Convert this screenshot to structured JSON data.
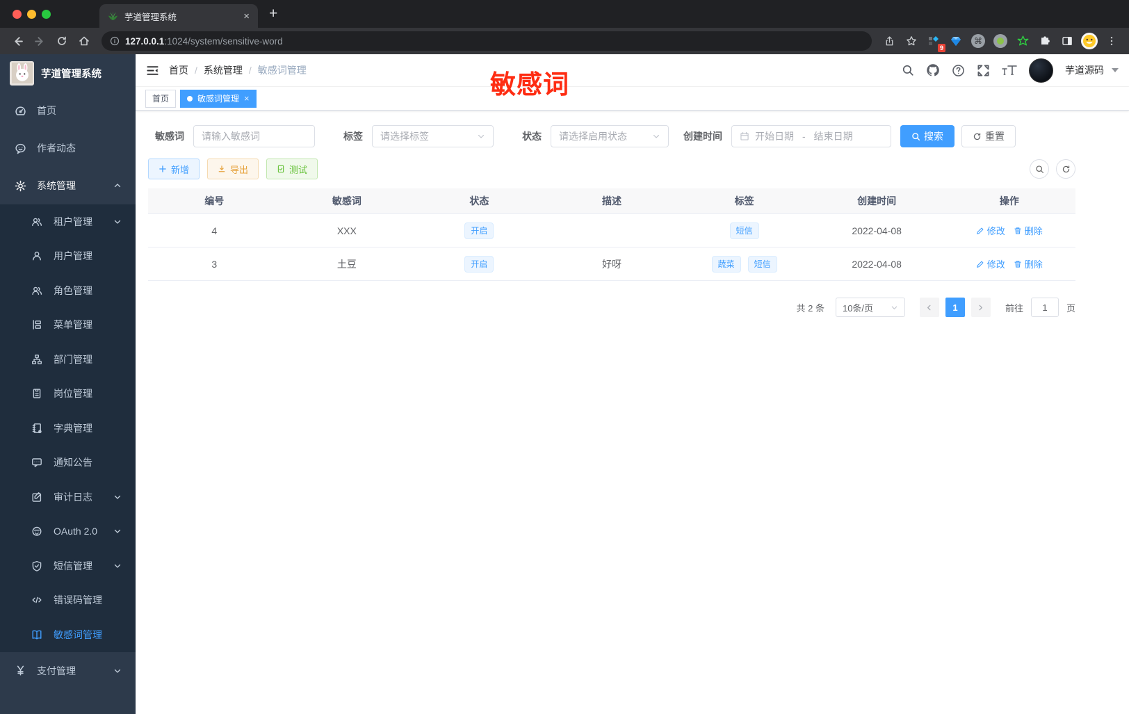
{
  "browser": {
    "tab_title": "芋道管理系统",
    "url_host": "127.0.0.1",
    "url_path": ":1024/system/sensitive-word",
    "extension_badge": "9",
    "new_tab": "+",
    "tab_close": "×"
  },
  "sidebar": {
    "logo_title": "芋道管理系统",
    "items": [
      {
        "label": "首页"
      },
      {
        "label": "作者动态"
      },
      {
        "label": "系统管理"
      }
    ],
    "sub_items": [
      {
        "label": "租户管理"
      },
      {
        "label": "用户管理"
      },
      {
        "label": "角色管理"
      },
      {
        "label": "菜单管理"
      },
      {
        "label": "部门管理"
      },
      {
        "label": "岗位管理"
      },
      {
        "label": "字典管理"
      },
      {
        "label": "通知公告"
      },
      {
        "label": "审计日志"
      },
      {
        "label": "OAuth 2.0"
      },
      {
        "label": "短信管理"
      },
      {
        "label": "错误码管理"
      },
      {
        "label": "敏感词管理"
      }
    ],
    "bottom_items": [
      {
        "label": "支付管理"
      }
    ]
  },
  "header": {
    "breadcrumb": [
      "首页",
      "系统管理",
      "敏感词管理"
    ],
    "separator": "/",
    "user_name": "芋道源码"
  },
  "annotation": {
    "text": "敏感词"
  },
  "tabs": [
    {
      "label": "首页"
    },
    {
      "label": "敏感词管理",
      "close": "×"
    }
  ],
  "filters": {
    "keyword_label": "敏感词",
    "keyword_placeholder": "请输入敏感词",
    "tag_label": "标签",
    "tag_placeholder": "请选择标签",
    "status_label": "状态",
    "status_placeholder": "请选择启用状态",
    "date_label": "创建时间",
    "date_start_placeholder": "开始日期",
    "date_separator": "-",
    "date_end_placeholder": "结束日期",
    "search_label": "搜索",
    "reset_label": "重置"
  },
  "toolbar": {
    "add_label": "新增",
    "export_label": "导出",
    "test_label": "测试"
  },
  "table": {
    "columns": [
      "编号",
      "敏感词",
      "状态",
      "描述",
      "标签",
      "创建时间",
      "操作"
    ],
    "rows": [
      {
        "id": "4",
        "word": "XXX",
        "status": "开启",
        "description": "",
        "tags": [
          "短信"
        ],
        "created": "2022-04-08",
        "edit": "修改",
        "delete": "删除"
      },
      {
        "id": "3",
        "word": "土豆",
        "status": "开启",
        "description": "好呀",
        "tags": [
          "蔬菜",
          "短信"
        ],
        "created": "2022-04-08",
        "edit": "修改",
        "delete": "删除"
      }
    ]
  },
  "pagination": {
    "total": "共 2 条",
    "page_size": "10条/页",
    "current_page": "1",
    "goto_label": "前往",
    "goto_value": "1",
    "page_unit": "页"
  },
  "colors": {
    "primary": "#409eff",
    "warning": "#e6a23c",
    "success": "#67c23a",
    "sidebar_bg": "#2d3a4b",
    "submenu_bg": "#1f2d3d",
    "annotation_red": "#fe2c12"
  }
}
